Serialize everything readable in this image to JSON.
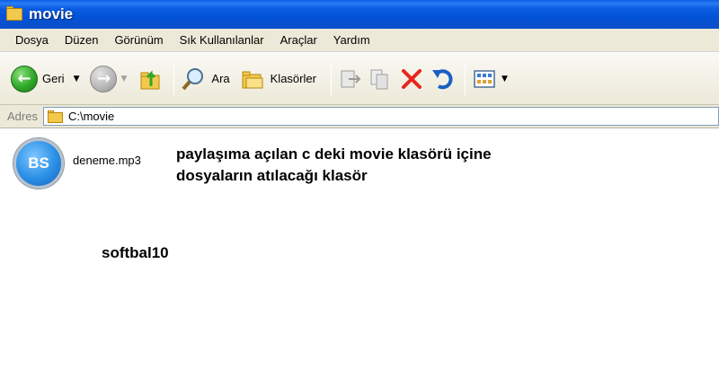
{
  "window": {
    "title": "movie"
  },
  "menu": {
    "items": [
      "Dosya",
      "Düzen",
      "Görünüm",
      "Sık Kullanılanlar",
      "Araçlar",
      "Yardım"
    ]
  },
  "toolbar": {
    "back_label": "Geri",
    "search_label": "Ara",
    "folders_label": "Klasörler"
  },
  "address": {
    "label": "Adres",
    "path": "C:\\movie"
  },
  "files": [
    {
      "name": "deneme.mp3",
      "icon": "bs-player-icon",
      "icon_text": "BS"
    }
  ],
  "annotation": {
    "line1": "paylaşıma açılan c deki movie klasörü içine",
    "line2": "dosyaların atılacağı klasör"
  },
  "signature": "softbal10",
  "colors": {
    "titlebar": "#0352d6",
    "chrome": "#ece9d8",
    "delete": "#e8251c"
  }
}
